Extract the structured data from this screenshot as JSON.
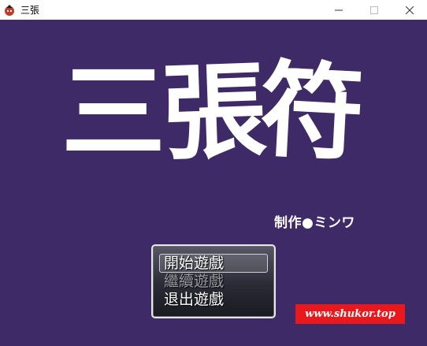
{
  "window": {
    "title": "三張",
    "icon": "game-app-icon",
    "controls": [
      "minimize-icon",
      "maximize-icon",
      "close-icon"
    ]
  },
  "game": {
    "title_chars": [
      "三",
      "張",
      "符"
    ],
    "credit": "制作●ミンワ",
    "background_color": "#3d2a66",
    "menu": {
      "items": [
        {
          "label": "開始遊戲",
          "enabled": true,
          "selected": true
        },
        {
          "label": "繼續遊戲",
          "enabled": false,
          "selected": false
        },
        {
          "label": "退出遊戲",
          "enabled": true,
          "selected": false
        }
      ]
    },
    "watermark": "www.shukor.top",
    "watermark_color": "#e8181d"
  }
}
